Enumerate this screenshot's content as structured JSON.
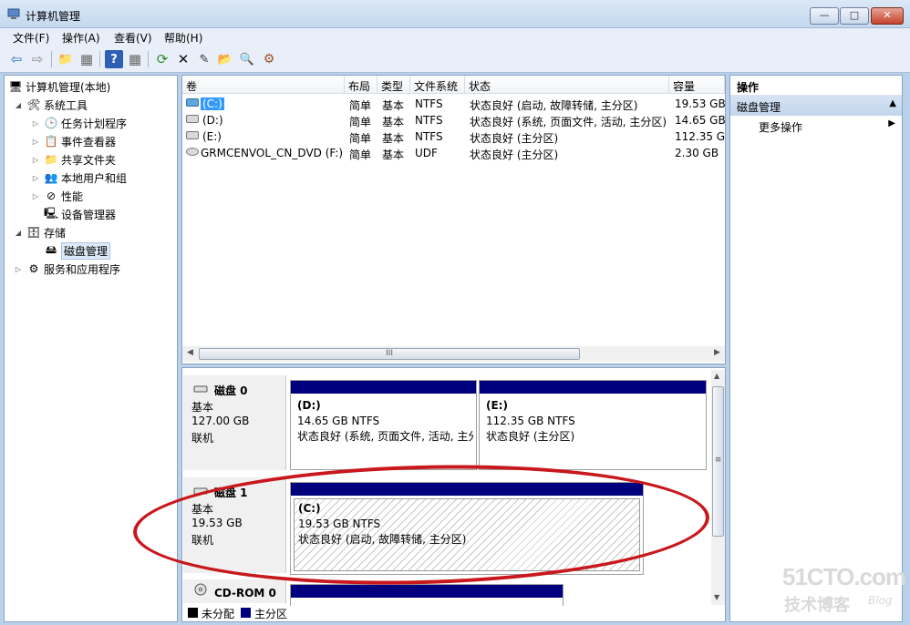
{
  "window": {
    "title": "计算机管理",
    "min_glyph": "—",
    "max_glyph": "□",
    "close_glyph": "✕"
  },
  "menu": [
    "文件(F)",
    "操作(A)",
    "查看(V)",
    "帮助(H)"
  ],
  "toolbar": {
    "icons": [
      "back-icon",
      "forward-icon",
      "up-icon",
      "show-hide-tree-icon",
      "help-icon",
      "show-hide-action-icon",
      "refresh-icon",
      "delete-icon",
      "properties-icon",
      "open-icon",
      "search-icon",
      "settings-icon"
    ],
    "glyphs": [
      "⇦",
      "⇨",
      "📁",
      "▦",
      "?",
      "▦",
      "⟳",
      "✕",
      "✎",
      "📂",
      "🔍",
      "⚙"
    ]
  },
  "tree": {
    "items": [
      {
        "label": "计算机管理(本地)",
        "level": 0,
        "expand": "",
        "icon": "🖥"
      },
      {
        "label": "系统工具",
        "level": 1,
        "expand": "◢",
        "icon": "🛠"
      },
      {
        "label": "任务计划程序",
        "level": 2,
        "expand": "▷",
        "icon": "🕒"
      },
      {
        "label": "事件查看器",
        "level": 2,
        "expand": "▷",
        "icon": "📋"
      },
      {
        "label": "共享文件夹",
        "level": 2,
        "expand": "▷",
        "icon": "📁"
      },
      {
        "label": "本地用户和组",
        "level": 2,
        "expand": "▷",
        "icon": "👥"
      },
      {
        "label": "性能",
        "level": 2,
        "expand": "▷",
        "icon": "⊘"
      },
      {
        "label": "设备管理器",
        "level": 2,
        "expand": "",
        "icon": "🖳"
      },
      {
        "label": "存储",
        "level": 1,
        "expand": "◢",
        "icon": "🗄"
      },
      {
        "label": "磁盘管理",
        "level": 2,
        "expand": "",
        "icon": "🖴"
      },
      {
        "label": "服务和应用程序",
        "level": 1,
        "expand": "▷",
        "icon": "⚙"
      }
    ]
  },
  "volumes": {
    "headers": [
      "卷",
      "布局",
      "类型",
      "文件系统",
      "状态",
      "容量"
    ],
    "rows": [
      [
        "(C:)",
        "简单",
        "基本",
        "NTFS",
        "状态良好 (启动, 故障转储, 主分区)",
        "19.53 GB"
      ],
      [
        "(D:)",
        "简单",
        "基本",
        "NTFS",
        "状态良好 (系统, 页面文件, 活动, 主分区)",
        "14.65 GB"
      ],
      [
        "(E:)",
        "简单",
        "基本",
        "NTFS",
        "状态良好 (主分区)",
        "112.35 GB"
      ],
      [
        "GRMCENVOL_CN_DVD (F:)",
        "简单",
        "基本",
        "UDF",
        "状态良好 (主分区)",
        "2.30 GB"
      ]
    ],
    "scroll_grip": "III"
  },
  "disks": [
    {
      "name": "磁盘 0",
      "type": "基本",
      "size": "127.00 GB",
      "status": "联机"
    },
    {
      "name": "磁盘 1",
      "type": "基本",
      "size": "19.53 GB",
      "status": "联机"
    },
    {
      "name": "CD-ROM 0"
    }
  ],
  "partitions": {
    "d": {
      "label": "(D:)",
      "size": "14.65 GB NTFS",
      "status": "状态良好 (系统, 页面文件, 活动, 主分"
    },
    "e": {
      "label": "(E:)",
      "size": "112.35 GB NTFS",
      "status": "状态良好 (主分区)"
    },
    "c": {
      "label": "(C:)",
      "size": "19.53 GB NTFS",
      "status": "状态良好 (启动, 故障转储, 主分区)"
    }
  },
  "legend": {
    "unallocated": "未分配",
    "primary": "主分区",
    "unallocated_color": "#000000",
    "primary_color": "#00007f"
  },
  "actions": {
    "header": "操作",
    "section": "磁盘管理",
    "more": "更多操作"
  },
  "watermark": {
    "site": "51CTO.com",
    "line2": "技术博客",
    "blog": "Blog"
  }
}
